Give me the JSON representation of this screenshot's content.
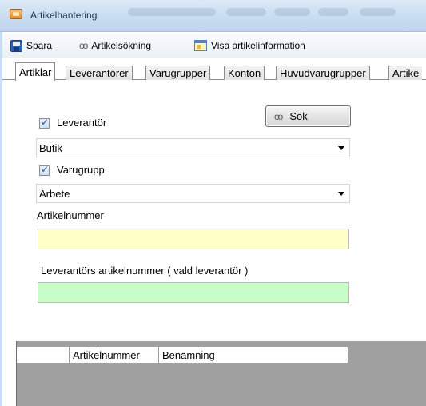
{
  "window": {
    "title": "Artikelhantering"
  },
  "toolbar": {
    "save_label": "Spara",
    "search_label": "Artikelsökning",
    "info_label": "Visa artikelinformation"
  },
  "tabs": [
    {
      "label": "Artiklar",
      "active": true
    },
    {
      "label": "Leverantörer",
      "active": false
    },
    {
      "label": "Varugrupper",
      "active": false
    },
    {
      "label": "Konton",
      "active": false
    },
    {
      "label": "Huvudvarugrupper",
      "active": false
    },
    {
      "label": "Artike",
      "active": false
    }
  ],
  "form": {
    "supplier_checkbox": {
      "label": "Leverantör",
      "checked": true
    },
    "search_button": "Sök",
    "supplier_value": "Butik",
    "group_checkbox": {
      "label": "Varugrupp",
      "checked": true
    },
    "group_value": "Arbete",
    "article_number_label": "Artikelnummer",
    "article_number_value": "",
    "supplier_article_number_label": "Leverantörs artikelnummer ( vald leverantör )",
    "supplier_article_number_value": ""
  },
  "grid": {
    "columns": [
      "",
      "Artikelnummer",
      "Benämning"
    ]
  },
  "colors": {
    "article_field_bg": "#ffffc7",
    "supplier_field_bg": "#c7fdc7",
    "grid_bg": "#a0a0a0"
  }
}
